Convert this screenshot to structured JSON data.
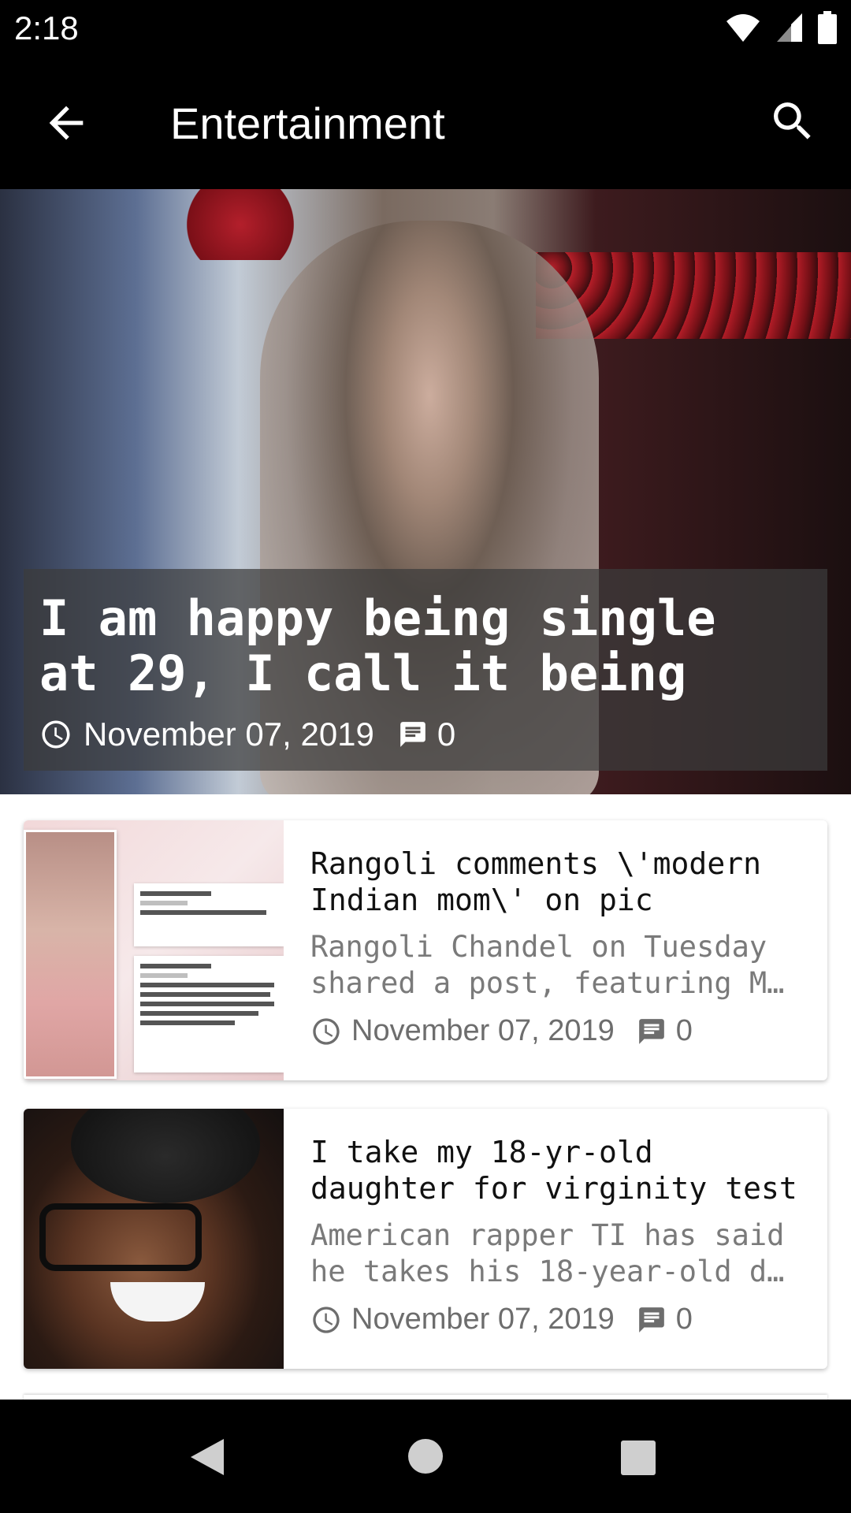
{
  "status_bar": {
    "time": "2:18",
    "icons": [
      "wifi-icon",
      "signal-icon",
      "battery-icon"
    ]
  },
  "app_bar": {
    "title": "Entertainment",
    "back_icon": "arrow-back-icon",
    "search_icon": "search-icon"
  },
  "hero": {
    "title": "I am happy being single\nat 29, I call it being",
    "date": "November 07, 2019",
    "comments": "0"
  },
  "articles": [
    {
      "title": "Rangoli comments \\'modern\nIndian mom\\' on pic",
      "excerpt": "Rangoli Chandel on Tuesday\nshared a post, featuring M…",
      "date": "November 07, 2019",
      "comments": "0"
    },
    {
      "title": "I take my 18-yr-old\ndaughter for virginity test",
      "excerpt": "American rapper TI has said\nhe takes his 18-year-old d…",
      "date": "November 07, 2019",
      "comments": "0"
    }
  ],
  "colors": {
    "app_bar_bg": "#000000",
    "card_bg": "#ffffff",
    "muted_text": "#7a7a7a"
  }
}
